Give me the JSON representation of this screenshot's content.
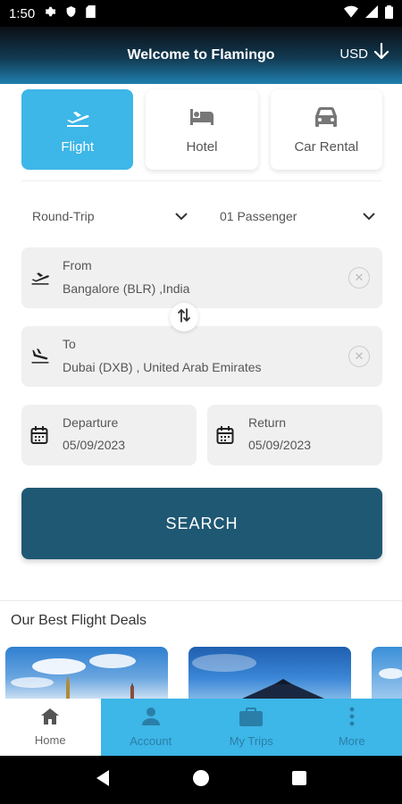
{
  "status_bar": {
    "time": "1:50"
  },
  "header": {
    "title": "Welcome to Flamingo",
    "currency": "USD"
  },
  "tabs": [
    {
      "label": "Flight",
      "active": true
    },
    {
      "label": "Hotel",
      "active": false
    },
    {
      "label": "Car Rental",
      "active": false
    }
  ],
  "trip_type": {
    "value": "Round-Trip"
  },
  "passengers": {
    "value": "01 Passenger"
  },
  "from": {
    "label": "From",
    "value": "Bangalore (BLR) ,India"
  },
  "to": {
    "label": "To",
    "value": "Dubai (DXB) , United Arab Emirates"
  },
  "departure": {
    "label": "Departure",
    "value": "05/09/2023"
  },
  "return": {
    "label": "Return",
    "value": "05/09/2023"
  },
  "search_button": {
    "label": "SEARCH"
  },
  "deals": {
    "title": "Our Best Flight Deals"
  },
  "bottom_nav": [
    {
      "label": "Home",
      "active": true
    },
    {
      "label": "Account",
      "active": false
    },
    {
      "label": "My Trips",
      "active": false
    },
    {
      "label": "More",
      "active": false
    }
  ],
  "colors": {
    "accent": "#3db6e8",
    "button": "#1f5873",
    "field_bg": "#f0f0f0"
  }
}
